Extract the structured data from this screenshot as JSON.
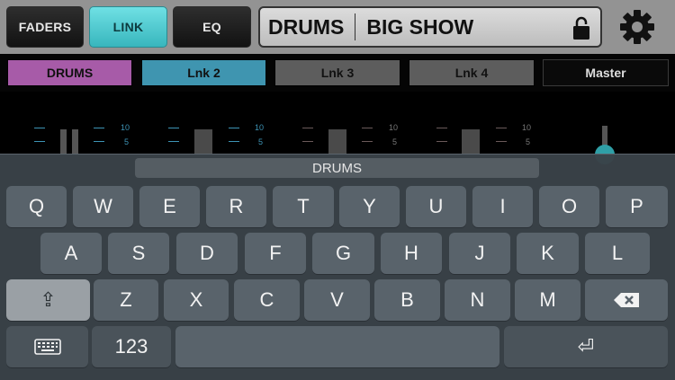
{
  "topbar": {
    "tabs": [
      {
        "label": "FADERS",
        "active": false
      },
      {
        "label": "LINK",
        "active": true
      },
      {
        "label": "EQ",
        "active": false
      }
    ],
    "title_left": "DRUMS",
    "title_right": "BIG SHOW",
    "icons": [
      "lock-icon",
      "gear-icon"
    ]
  },
  "links": [
    {
      "label": "DRUMS",
      "color": "#a75ba8"
    },
    {
      "label": "Lnk 2",
      "color": "#3f95b0"
    },
    {
      "label": "Lnk 3",
      "color": "#5d5d5d"
    },
    {
      "label": "Lnk 4",
      "color": "#5d5d5d"
    },
    {
      "label": "Master",
      "color": "#0a0a0a"
    }
  ],
  "meters": {
    "strip1": {
      "top": "10",
      "bottom": "5"
    },
    "strip2": {
      "top": "10",
      "bottom": "5"
    },
    "strip3": {
      "top": "10",
      "bottom": "5"
    },
    "strip4": {
      "top": "10",
      "bottom": "5"
    }
  },
  "keyboard": {
    "text_value": "DRUMS",
    "row1": [
      "Q",
      "W",
      "E",
      "R",
      "T",
      "Y",
      "U",
      "I",
      "O",
      "P"
    ],
    "row2": [
      "A",
      "S",
      "D",
      "F",
      "G",
      "H",
      "J",
      "K",
      "L"
    ],
    "row3": [
      "Z",
      "X",
      "C",
      "V",
      "B",
      "N",
      "M"
    ],
    "numbers_label": "123",
    "shift_glyph": "⇪",
    "return_glyph": "⏎"
  }
}
